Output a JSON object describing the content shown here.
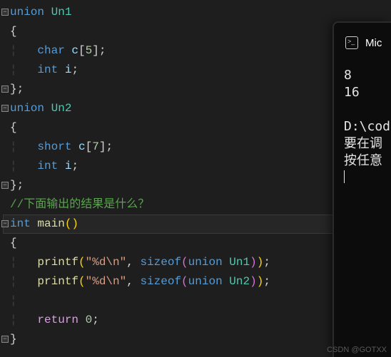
{
  "code": {
    "l1_kw": "union",
    "l1_id": "Un1",
    "l2_brace": "{",
    "l3_kw": "char",
    "l3_var": "c",
    "l3_num": "5",
    "l4_kw": "int",
    "l4_var": "i",
    "l5_brace": "};",
    "l6_kw": "union",
    "l6_id": "Un2",
    "l7_brace": "{",
    "l8_kw": "short",
    "l8_var": "c",
    "l8_num": "7",
    "l9_kw": "int",
    "l9_var": "i",
    "l10_brace": "};",
    "l11_comment": "//下面输出的结果是什么？",
    "l12_kw": "int",
    "l12_fn": "main",
    "l13_brace": "{",
    "l14_fn": "printf",
    "l14_str": "\"%d\\n\"",
    "l14_sz": "sizeof",
    "l14_un": "union",
    "l14_id": "Un1",
    "l15_fn": "printf",
    "l15_str": "\"%d\\n\"",
    "l15_sz": "sizeof",
    "l15_un": "union",
    "l15_id": "Un2",
    "l17_kw": "return",
    "l17_num": "0",
    "l18_brace": "}"
  },
  "terminal": {
    "title_prefix": "Mic",
    "out1": "8",
    "out2": "16",
    "path": "D:\\code",
    "msg1": "要在调",
    "msg2": "按任意"
  },
  "watermark": "CSDN @GOTXX"
}
